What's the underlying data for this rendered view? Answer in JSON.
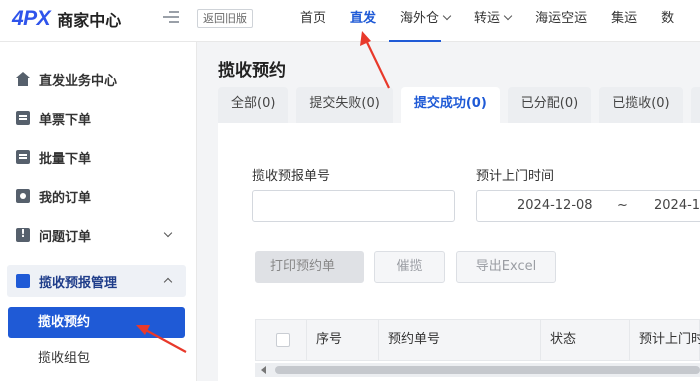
{
  "brand": {
    "logo_mark": "4PX",
    "title": "商家中心"
  },
  "header": {
    "back_label": "返回旧版",
    "nav": [
      {
        "label": "首页"
      },
      {
        "label": "直发"
      },
      {
        "label": "海外仓"
      },
      {
        "label": "转运"
      },
      {
        "label": "海运空运"
      },
      {
        "label": "集运"
      },
      {
        "label": "数"
      }
    ]
  },
  "sidebar": {
    "items": [
      {
        "label": "直发业务中心",
        "icon": "home-icon"
      },
      {
        "label": "单票下单",
        "icon": "document-icon"
      },
      {
        "label": "批量下单",
        "icon": "batch-icon"
      },
      {
        "label": "我的订单",
        "icon": "order-icon"
      },
      {
        "label": "问题订单",
        "icon": "problem-icon"
      }
    ],
    "group": {
      "label": "揽收预报管理",
      "icon": "truck-icon"
    },
    "sub_items": [
      {
        "label": "揽收预约"
      },
      {
        "label": "揽收组包"
      }
    ]
  },
  "main": {
    "page_title": "揽收预约",
    "tabs": [
      {
        "label": "全部(0)"
      },
      {
        "label": "提交失败(0)"
      },
      {
        "label": "提交成功(0)"
      },
      {
        "label": "已分配(0)"
      },
      {
        "label": "已揽收(0)"
      },
      {
        "label": "已"
      }
    ],
    "filters": {
      "order_no_label": "揽收预报单号",
      "order_no_value": "",
      "date_label": "预计上门时间",
      "date_start": "2024-12-08",
      "date_sep": "~",
      "date_end": "2024-1"
    },
    "buttons": {
      "print": "打印预约单",
      "urge": "催揽",
      "export": "导出Excel"
    },
    "table": {
      "columns": [
        "序号",
        "预约单号",
        "状态",
        "预计上门时"
      ]
    }
  },
  "colors": {
    "accent": "#1f5ad6",
    "annotation_arrow": "#e8392b"
  }
}
